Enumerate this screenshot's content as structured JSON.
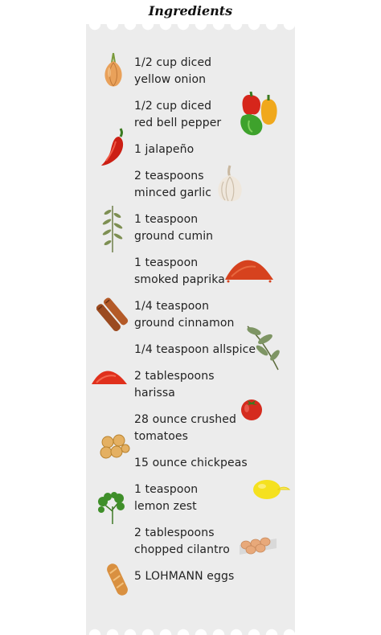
{
  "title": "Ingredients",
  "ingredients": [
    {
      "line1": "1/2 cup diced",
      "line2": "yellow onion",
      "icon": "onion-icon"
    },
    {
      "line1": "1/2 cup diced",
      "line2": "red bell pepper",
      "icon": "bell-pepper-icon"
    },
    {
      "line1": "1 jalapeño",
      "line2": "",
      "icon": "chili-pepper-icon"
    },
    {
      "line1": "2 teaspoons",
      "line2": "minced garlic",
      "icon": "garlic-icon"
    },
    {
      "line1": "1 teaspoon",
      "line2": "ground cumin",
      "icon": "herb-sprig-icon"
    },
    {
      "line1": "1 teaspoon",
      "line2": "smoked paprika",
      "icon": "paprika-pile-icon"
    },
    {
      "line1": "1/4 teaspoon",
      "line2": "ground cinnamon",
      "icon": "cinnamon-icon"
    },
    {
      "line1": "1/4 teaspoon allspice",
      "line2": "",
      "icon": "bay-leaf-icon"
    },
    {
      "line1": "2 tablespoons",
      "line2": "harissa",
      "icon": "harissa-pile-icon"
    },
    {
      "line1": "28 ounce crushed",
      "line2": "tomatoes",
      "icon": "tomato-icon"
    },
    {
      "line1": "15 ounce chickpeas",
      "line2": "",
      "icon": "chickpeas-icon"
    },
    {
      "line1": "1 teaspoon",
      "line2": "lemon zest",
      "icon": "lemon-icon"
    },
    {
      "line1": "2 tablespoons",
      "line2": "chopped cilantro",
      "icon": "cilantro-icon"
    },
    {
      "line1": "5 LOHMANN eggs",
      "line2": "",
      "icon": "eggs-icon"
    }
  ],
  "extra_icons": [
    "bread-icon"
  ],
  "colors": {
    "ticket": "#ececec",
    "text": "#222222",
    "background": "#ffffff"
  }
}
